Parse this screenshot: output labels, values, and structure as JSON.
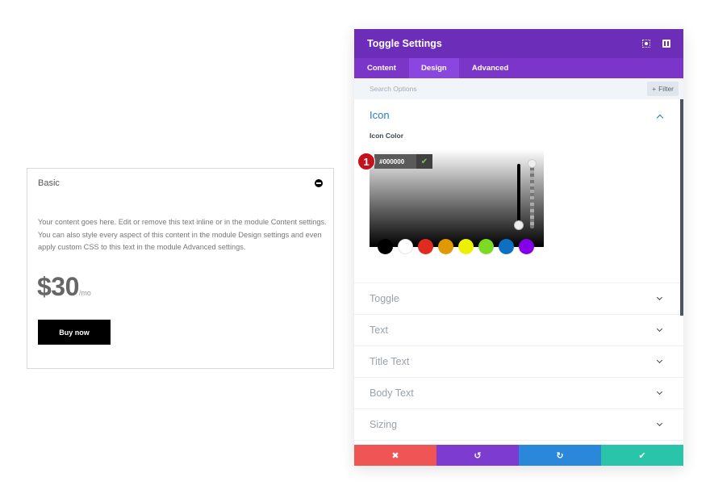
{
  "preview": {
    "title": "Basic",
    "body": "Your content goes here. Edit or remove this text inline or in the module Content settings. You can also style every aspect of this content in the module Design settings and even apply custom CSS to this text in the module Advanced settings.",
    "price": "$30",
    "price_suffix": "/mo",
    "button_label": "Buy now"
  },
  "panel": {
    "title": "Toggle Settings",
    "header_icons": [
      "focus-icon",
      "split-view-icon"
    ],
    "tabs": [
      {
        "label": "Content",
        "active": false
      },
      {
        "label": "Design",
        "active": true
      },
      {
        "label": "Advanced",
        "active": false
      }
    ],
    "search": {
      "placeholder": "Search Options",
      "value": ""
    },
    "filter_label": "Filter",
    "icon_section": {
      "title": "Icon",
      "expanded": true,
      "field_label": "Icon Color",
      "hex_value": "#000000",
      "step_number": "1",
      "swatches": [
        "#000000",
        "#ffffff",
        "#e02b20",
        "#e09900",
        "#edf000",
        "#7cda24",
        "#0c71c3",
        "#8300e9"
      ]
    },
    "sections": [
      {
        "label": "Toggle"
      },
      {
        "label": "Text"
      },
      {
        "label": "Title Text"
      },
      {
        "label": "Body Text"
      },
      {
        "label": "Sizing"
      }
    ],
    "footer": [
      {
        "name": "cancel",
        "glyph": "✖",
        "color": "#ef5555"
      },
      {
        "name": "undo",
        "glyph": "↺",
        "color": "#7e3bd0"
      },
      {
        "name": "redo",
        "glyph": "↻",
        "color": "#2b87da"
      },
      {
        "name": "save",
        "glyph": "✔",
        "color": "#29c4a9"
      }
    ]
  }
}
